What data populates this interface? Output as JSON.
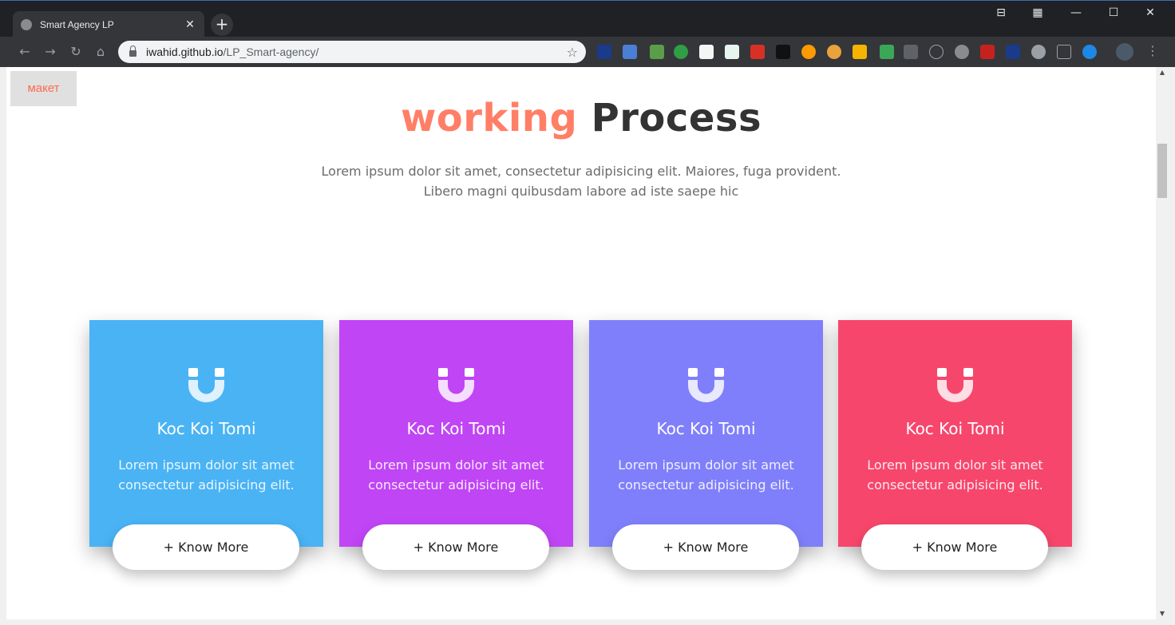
{
  "browser": {
    "tab_title": "Smart Agency LP",
    "tab_close": "✕",
    "new_tab": "+",
    "url_host": "iwahid.github.io",
    "url_path": "/LP_Smart-agency/",
    "controls": {
      "pin": "⊟",
      "minimize": "—",
      "maximize": "☐",
      "close": "✕"
    }
  },
  "page": {
    "maket_label": "макет",
    "heading_accent": "working",
    "heading_rest": "Process",
    "subtext": "Lorem ipsum dolor sit amet, consectetur adipisicing elit. Maiores, fuga provident. Libero magni quibusdam labore ad iste saepe hic",
    "cards": [
      {
        "title": "Koc Koi Tomi",
        "text": "Lorem ipsum dolor sit amet consectetur adipisicing elit.",
        "button": "+ Know More",
        "color": "#4ab3f4"
      },
      {
        "title": "Koc Koi Tomi",
        "text": "Lorem ipsum dolor sit amet consectetur adipisicing elit.",
        "button": "+ Know More",
        "color": "#c045f5"
      },
      {
        "title": "Koc Koi Tomi",
        "text": "Lorem ipsum dolor sit amet consectetur adipisicing elit.",
        "button": "+ Know More",
        "color": "#7f7ffb"
      },
      {
        "title": "Koc Koi Tomi",
        "text": "Lorem ipsum dolor sit amet consectetur adipisicing elit.",
        "button": "+ Know More",
        "color": "#f7466c"
      }
    ],
    "card_icon": "magnet-icon"
  }
}
